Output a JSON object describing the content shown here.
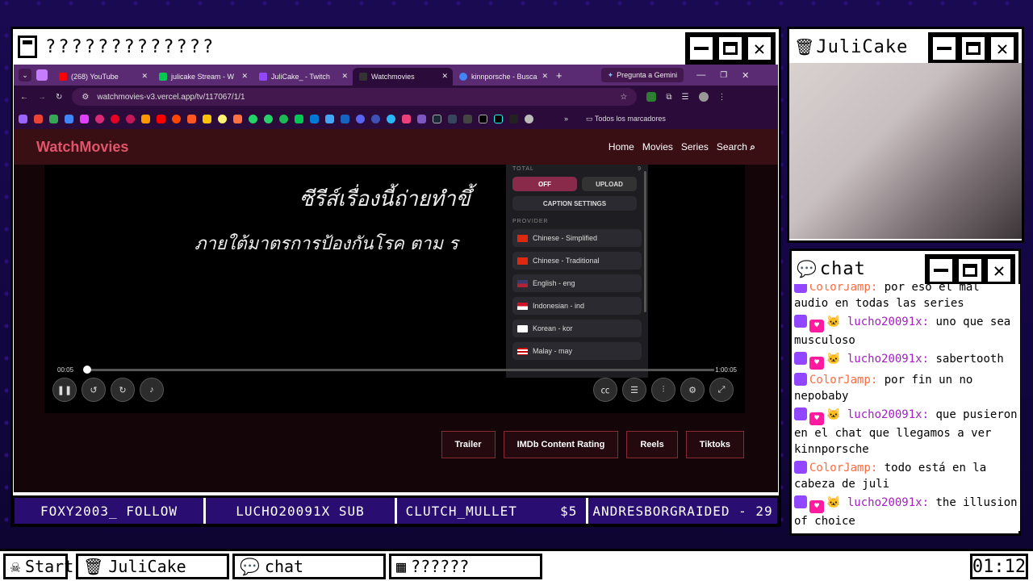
{
  "overlay": {
    "main_window_title": "?????????????",
    "cam_window_title": "JuliCake",
    "chat_window_title": "chat"
  },
  "browser": {
    "tabs": [
      {
        "label": "(268) YouTube",
        "color": "#ff0000"
      },
      {
        "label": "julicake Stream - W",
        "color": "#00c853"
      },
      {
        "label": "JuliCake_ - Twitch",
        "color": "#9146ff"
      },
      {
        "label": "Watchmovies",
        "color": "#333333"
      },
      {
        "label": "kinnporsche - Busca",
        "color": "#4285f4"
      }
    ],
    "gemini_label": "Pregunta a Gemini",
    "url": "watchmovies-v3.vercel.app/tv/117067/1/1",
    "bookmarks_label": "Todos los marcadores"
  },
  "site": {
    "logo": "WatchMovies",
    "nav": [
      "Home",
      "Movies",
      "Series",
      "Search"
    ],
    "subtitle_line1": "ซีรีส์เรื่องนี้ถ่ายทำขึ้",
    "subtitle_line2": "ภายใต้มาตรการป้องกันโรค ตาม ร",
    "time_current": "00:05",
    "time_total": "1:00:05",
    "progress": 0.003,
    "captions_menu": {
      "total_label": "TOTAL",
      "total_count": "9",
      "off_label": "OFF",
      "upload_label": "UPLOAD",
      "settings_label": "CAPTION SETTINGS",
      "provider_label": "PROVIDER",
      "providers": [
        {
          "name": "Chinese - Simplified",
          "flag": "cn"
        },
        {
          "name": "Chinese - Traditional",
          "flag": "cn"
        },
        {
          "name": "English - eng",
          "flag": "us"
        },
        {
          "name": "Indonesian - ind",
          "flag": "id"
        },
        {
          "name": "Korean - kor",
          "flag": "kr"
        },
        {
          "name": "Malay - may",
          "flag": "my"
        }
      ]
    },
    "bottom_buttons": [
      "Trailer",
      "IMDb Content Rating",
      "Reels",
      "Tiktoks"
    ]
  },
  "ticker": [
    "FOXY2003_ FOLLOW",
    "LUCHO20091X SUB",
    "CLUTCH_MULLET     $5",
    "ANDRESBORGRAIDED - 29"
  ],
  "chat": [
    {
      "user": "ColorJamp:",
      "color": "#ff6a3d",
      "text": "por eso el mal audio en todas las series",
      "heart": false
    },
    {
      "user": "lucho20091x:",
      "color": "#a020c0",
      "text": "uno que sea musculoso",
      "heart": true
    },
    {
      "user": "lucho20091x:",
      "color": "#a020c0",
      "text": "sabertooth",
      "heart": true
    },
    {
      "user": "ColorJamp:",
      "color": "#ff6a3d",
      "text": "por fin un no nepobaby",
      "heart": false
    },
    {
      "user": "lucho20091x:",
      "color": "#a020c0",
      "text": "que pusieron en el chat que llegamos a ver kinnporsche",
      "heart": true
    },
    {
      "user": "ColorJamp:",
      "color": "#ff6a3d",
      "text": "todo está en la cabeza de juli",
      "heart": false
    },
    {
      "user": "lucho20091x:",
      "color": "#a020c0",
      "text": "the illusion of choice",
      "heart": true
    }
  ],
  "taskbar": {
    "start": "Start",
    "items": [
      "JuliCake",
      "chat",
      "??????"
    ],
    "clock": "01:12"
  }
}
